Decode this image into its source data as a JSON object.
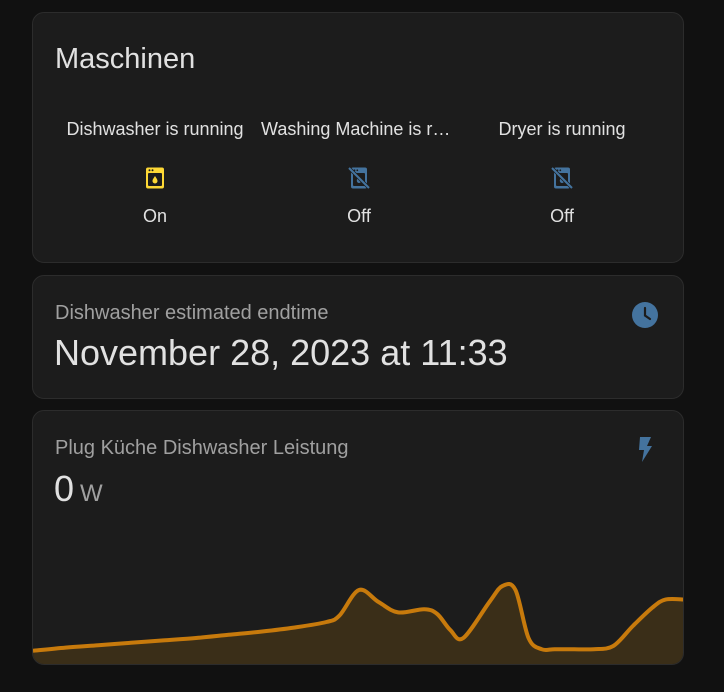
{
  "machines_card": {
    "title": "Maschinen",
    "entities": [
      {
        "name": "Dishwasher is running",
        "state": "On",
        "icon": "dishwasher-icon",
        "color": "#fdd835"
      },
      {
        "name": "Washing Machine is running",
        "state": "Off",
        "icon": "washing-machine-off-icon",
        "color": "#44739e"
      },
      {
        "name": "Dryer is running",
        "state": "Off",
        "icon": "dryer-off-icon",
        "color": "#44739e"
      }
    ]
  },
  "endtime_card": {
    "name": "Dishwasher estimated endtime",
    "value": "November 28, 2023 at 11:33",
    "icon": "clock-icon",
    "icon_color": "#44739e"
  },
  "power_card": {
    "name": "Plug Küche Dishwasher Leistung",
    "value": "0",
    "unit": "W",
    "icon": "flash-icon",
    "icon_color": "#44739e",
    "line_color": "#c77a0c",
    "fill_color": "#3a2e18"
  },
  "chart_data": {
    "type": "area",
    "x": [
      0,
      0.05,
      0.1,
      0.15,
      0.2,
      0.25,
      0.3,
      0.35,
      0.4,
      0.45,
      0.47,
      0.5,
      0.53,
      0.56,
      0.6,
      0.62,
      0.64,
      0.66,
      0.7,
      0.72,
      0.74,
      0.76,
      0.78,
      0.8,
      0.83,
      0.86,
      0.89,
      0.92,
      0.95,
      0.97,
      1.0
    ],
    "values": [
      0.04,
      0.08,
      0.11,
      0.14,
      0.17,
      0.2,
      0.24,
      0.28,
      0.33,
      0.4,
      0.48,
      0.8,
      0.65,
      0.52,
      0.56,
      0.5,
      0.3,
      0.2,
      0.65,
      0.85,
      0.8,
      0.2,
      0.06,
      0.06,
      0.06,
      0.06,
      0.1,
      0.35,
      0.58,
      0.68,
      0.68
    ],
    "ylim": [
      0,
      1
    ],
    "grid": false
  }
}
